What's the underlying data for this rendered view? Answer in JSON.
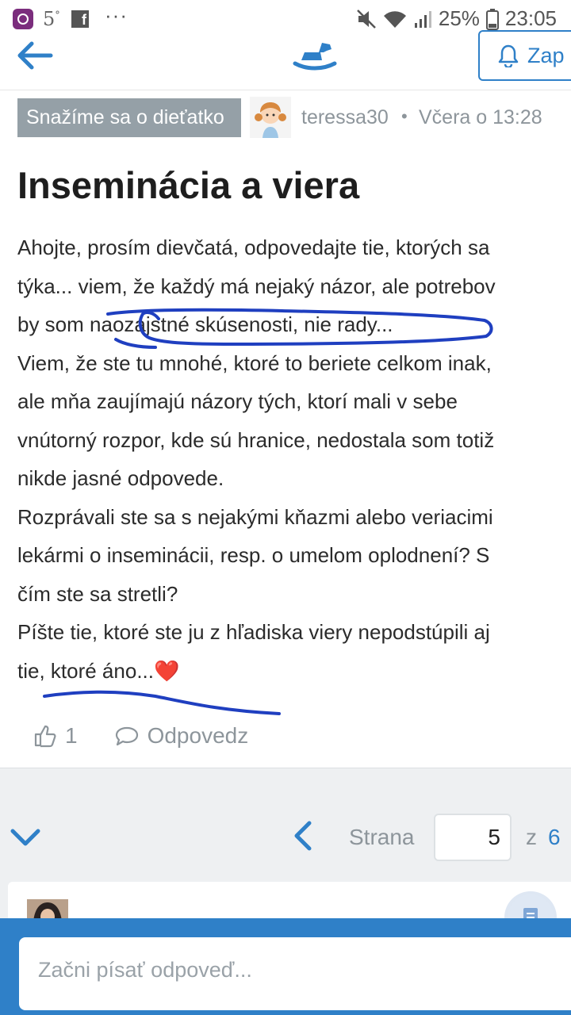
{
  "status_bar": {
    "temperature": "5",
    "temperature_unit": "°",
    "battery": "25%",
    "time": "23:05",
    "more": "···",
    "icons": [
      "app-notification-icon",
      "facebook-icon",
      "mute-icon",
      "wifi-icon",
      "signal-icon",
      "battery-icon"
    ]
  },
  "header": {
    "back_icon": "arrow-left-icon",
    "logo_icon": "rocking-horse-icon",
    "notify_label": "Zap",
    "accent": "#2f80c8"
  },
  "post": {
    "category": "Snažíme sa o dieťatko",
    "author": "teressa30",
    "separator": "•",
    "timestamp": "Včera o 13:28",
    "title": "Inseminácia a viera",
    "lines": [
      "Ahojte, prosím dievčatá, odpovedajte tie, ktorých sa",
      "týka... viem, že každý má nejaký názor, ale potrebov",
      "by som naozajstné skúsenosti, nie rady...",
      "Viem, že ste tu mnohé, ktoré to beriete celkom inak,",
      "ale mňa zaujímajú názory tých, ktorí mali v sebe",
      "vnútorný rozpor, kde sú hranice, nedostala som totiž",
      "nikde jasné odpovede.",
      "Rozprávali ste sa s nejakými kňazmi alebo veriacimi",
      "lekármi o inseminácii, resp. o umelom oplodnení? S",
      "čím ste sa stretli?",
      "Píšte tie, ktoré ste ju z hľadiska viery nepodstúpili aj",
      "tie, ktoré áno...❤️"
    ],
    "like_count": "1",
    "reply_label": "Odpovedz"
  },
  "pagination": {
    "label": "Strana",
    "current": "5",
    "of": "z",
    "total": "6"
  },
  "composer": {
    "placeholder": "Začni písať odpoveď..."
  }
}
